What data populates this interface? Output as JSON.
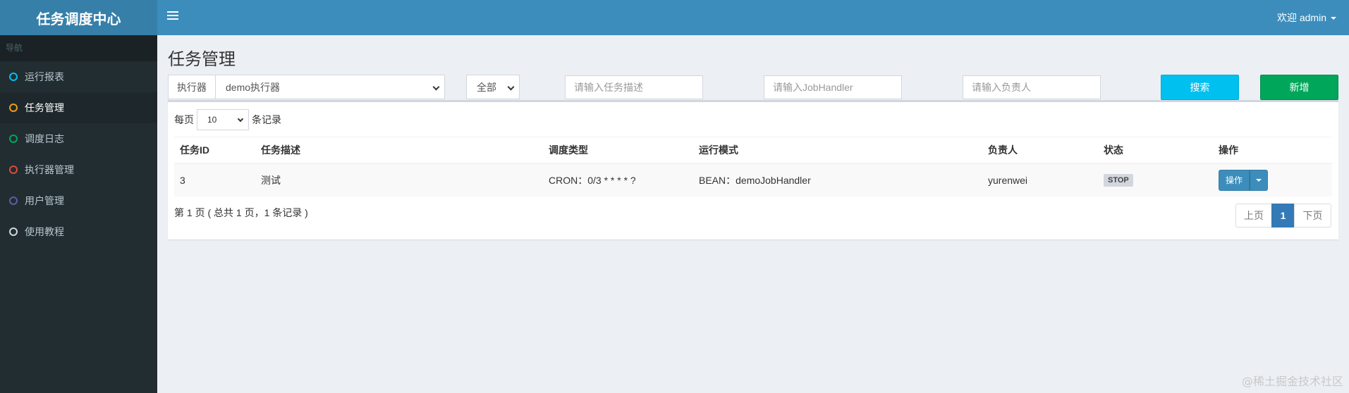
{
  "app": {
    "title": "任务调度中心"
  },
  "header": {
    "user_label": "欢迎 admin"
  },
  "sidebar": {
    "header": "导航",
    "items": [
      {
        "label": "运行报表",
        "color": "#00c0ef"
      },
      {
        "label": "任务管理",
        "color": "#f39c12",
        "active": true
      },
      {
        "label": "调度日志",
        "color": "#00a65a"
      },
      {
        "label": "执行器管理",
        "color": "#dd4b39"
      },
      {
        "label": "用户管理",
        "color": "#605ca8"
      },
      {
        "label": "使用教程",
        "color": "#d2d6de"
      }
    ]
  },
  "main": {
    "page_title": "任务管理",
    "filters": {
      "executor_label": "执行器",
      "executor_value": "demo执行器",
      "status_value": "全部",
      "desc_placeholder": "请输入任务描述",
      "handler_placeholder": "请输入JobHandler",
      "author_placeholder": "请输入负责人",
      "search_label": "搜索",
      "add_label": "新增"
    },
    "length": {
      "prefix": "每页",
      "value": "10",
      "suffix": "条记录"
    },
    "table": {
      "columns": [
        "任务ID",
        "任务描述",
        "调度类型",
        "运行模式",
        "负责人",
        "状态",
        "操作"
      ],
      "rows": [
        {
          "id": "3",
          "desc": "测试",
          "schedule": "CRON：0/3 * * * * ?",
          "mode": "BEAN：demoJobHandler",
          "author": "yurenwei",
          "status": "STOP",
          "action": "操作"
        }
      ]
    },
    "pagination": {
      "info": "第 1 页 ( 总共 1 页，1 条记录 )",
      "prev": "上页",
      "current": "1",
      "next": "下页"
    }
  },
  "watermark": "@稀土掘金技术社区"
}
